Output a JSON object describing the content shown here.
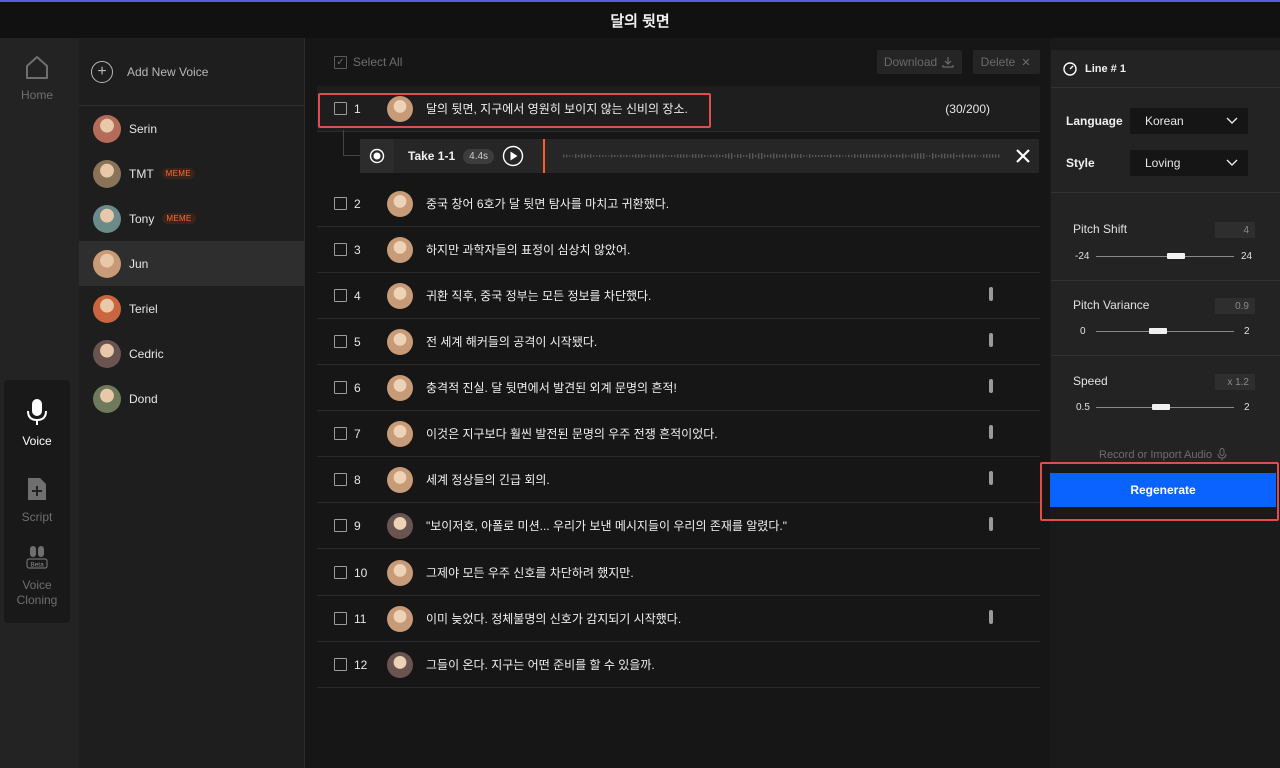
{
  "app": {
    "title": "달의 뒷면"
  },
  "rail": {
    "home": "Home",
    "voice": "Voice",
    "script": "Script",
    "clone_line1": "Voice",
    "clone_line2": "Cloning",
    "beta": "Beta"
  },
  "voices": {
    "add_label": "Add New Voice",
    "items": [
      {
        "name": "Serin",
        "badge": "",
        "color": "#b56b5a"
      },
      {
        "name": "TMT",
        "badge": "MEME",
        "color": "#8a7356"
      },
      {
        "name": "Tony",
        "badge": "MEME",
        "color": "#6b8a8a"
      },
      {
        "name": "Jun",
        "badge": "",
        "color": "#c79a78"
      },
      {
        "name": "Teriel",
        "badge": "",
        "color": "#c9663f"
      },
      {
        "name": "Cedric",
        "badge": "",
        "color": "#6a5450"
      },
      {
        "name": "Dond",
        "badge": "",
        "color": "#6f7a5c"
      }
    ],
    "active_index": 3
  },
  "toolbar": {
    "select_all": "Select All",
    "download": "Download",
    "delete": "Delete"
  },
  "lines": [
    {
      "num": "1",
      "text": "달의 뒷면, 지구에서 영원히 보이지 않는 신비의 장소.",
      "count": "(30/200)",
      "handle": false
    },
    {
      "num": "2",
      "text": "중국 창어 6호가 달 뒷면 탐사를 마치고 귀환했다.",
      "count": "",
      "handle": false
    },
    {
      "num": "3",
      "text": "하지만 과학자들의 표정이 심상치 않았어.",
      "count": "",
      "handle": false
    },
    {
      "num": "4",
      "text": "귀환 직후, 중국 정부는 모든 정보를 차단했다.",
      "count": "",
      "handle": true
    },
    {
      "num": "5",
      "text": "전 세계 해커들의 공격이 시작됐다.",
      "count": "",
      "handle": true
    },
    {
      "num": "6",
      "text": "충격적 진실. 달 뒷면에서 발견된 외계 문명의 흔적!",
      "count": "",
      "handle": true
    },
    {
      "num": "7",
      "text": "이것은 지구보다 훨씬 발전된 문명의 우주 전쟁 흔적이었다.",
      "count": "",
      "handle": true
    },
    {
      "num": "8",
      "text": "세계 정상들의 긴급 회의.",
      "count": "",
      "handle": true
    },
    {
      "num": "9",
      "text": "\"보이저호, 아폴로 미션... 우리가 보낸 메시지들이 우리의 존재를 알렸다.\"",
      "count": "",
      "handle": true
    },
    {
      "num": "10",
      "text": "그제야 모든 우주 신호를 차단하려 했지만.",
      "count": "",
      "handle": false
    },
    {
      "num": "11",
      "text": "이미 늦었다. 정체불명의 신호가 감지되기 시작했다.",
      "count": "",
      "handle": true
    },
    {
      "num": "12",
      "text": "그들이 온다. 지구는 어떤 준비를 할 수 있을까.",
      "count": "",
      "handle": false
    }
  ],
  "take": {
    "label": "Take 1-1",
    "duration": "4.4s"
  },
  "panel": {
    "title": "Line # 1",
    "language_label": "Language",
    "language_value": "Korean",
    "style_label": "Style",
    "style_value": "Loving",
    "pitch_shift": {
      "label": "Pitch Shift",
      "value": "4",
      "min": "-24",
      "max": "24",
      "level": 0.58
    },
    "pitch_variance": {
      "label": "Pitch Variance",
      "value": "0.9",
      "min": "0",
      "max": "2",
      "level": 0.45
    },
    "speed": {
      "label": "Speed",
      "value": "x 1.2",
      "min": "0.5",
      "max": "2",
      "level": 0.47
    },
    "record_label": "Record or Import Audio",
    "regenerate": "Regenerate"
  }
}
